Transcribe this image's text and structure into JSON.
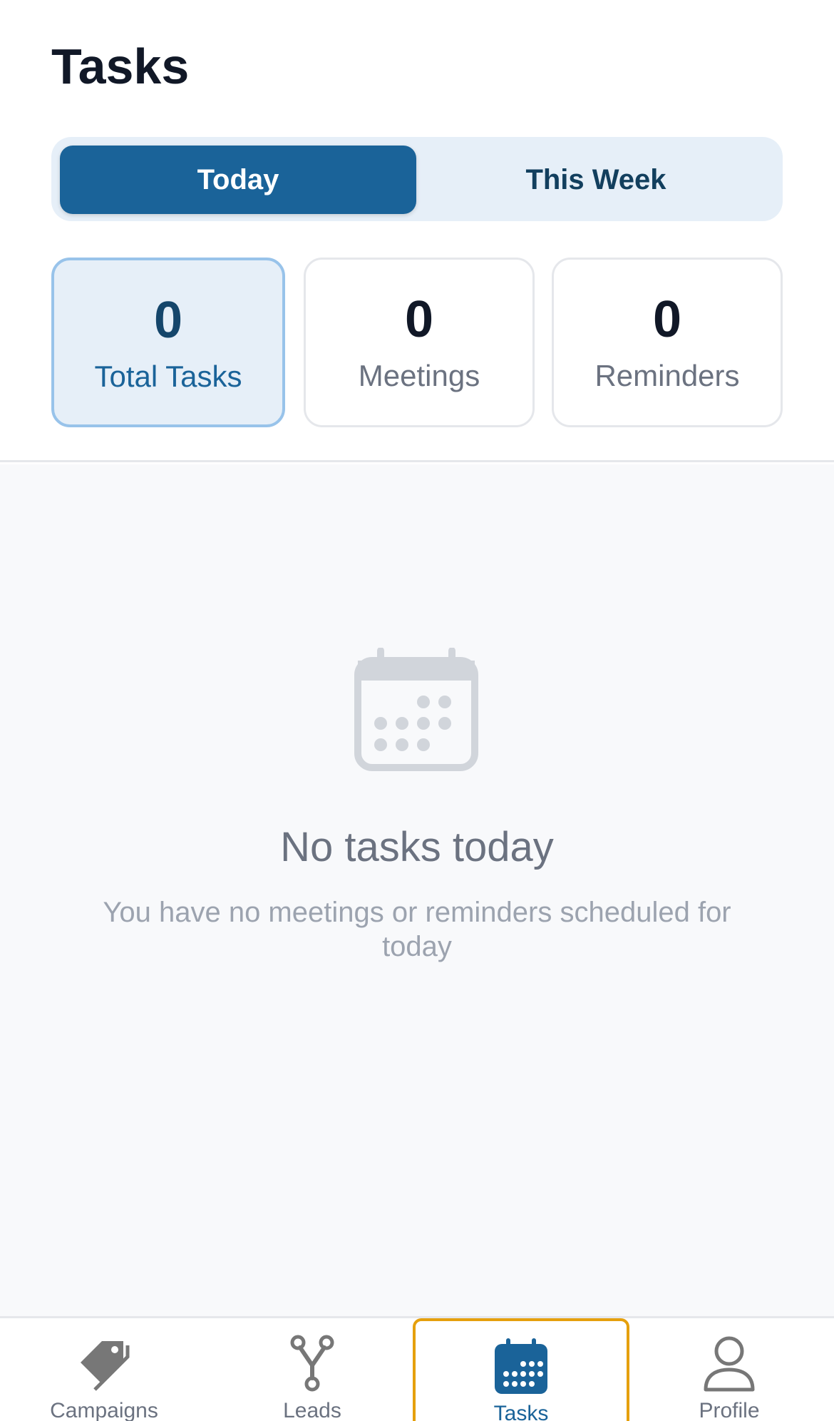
{
  "header": {
    "title": "Tasks"
  },
  "segments": {
    "today": "Today",
    "this_week": "This Week",
    "selected": "Today"
  },
  "stats": [
    {
      "value": "0",
      "label": "Total Tasks"
    },
    {
      "value": "0",
      "label": "Meetings"
    },
    {
      "value": "0",
      "label": "Reminders"
    }
  ],
  "empty_state": {
    "icon": "calendar-icon",
    "title": "No tasks today",
    "subtitle": "You have no meetings or reminders scheduled for today"
  },
  "bottom_nav": {
    "items": [
      {
        "label": "Campaigns",
        "icon": "tags-icon"
      },
      {
        "label": "Leads",
        "icon": "fork-icon"
      },
      {
        "label": "Tasks",
        "icon": "calendar-icon"
      },
      {
        "label": "Profile",
        "icon": "person-icon"
      }
    ],
    "active": "Tasks"
  },
  "colors": {
    "primary": "#1a6399",
    "active_tab_outline": "#e5a00d",
    "selected_card_bg": "#e6eff8",
    "empty_icon": "#d1d5db"
  }
}
